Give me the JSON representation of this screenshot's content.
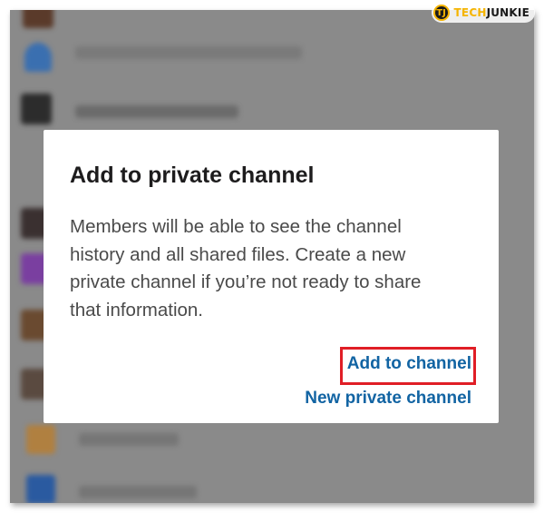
{
  "logo": {
    "badge": "TJ",
    "tech": "TECH",
    "junkie": "JUNKIE"
  },
  "dialog": {
    "title": "Add to private channel",
    "body_lines": [
      "Members will be able to see the channel",
      "history and all shared files. Create a new",
      "private channel if you’re not ready to share",
      "that information."
    ],
    "primary_button": "Add to channel",
    "secondary_button": "New private channel"
  },
  "colors": {
    "link": "#1264a3",
    "highlight": "#e01e26",
    "overlay": "#8a8a8a"
  }
}
